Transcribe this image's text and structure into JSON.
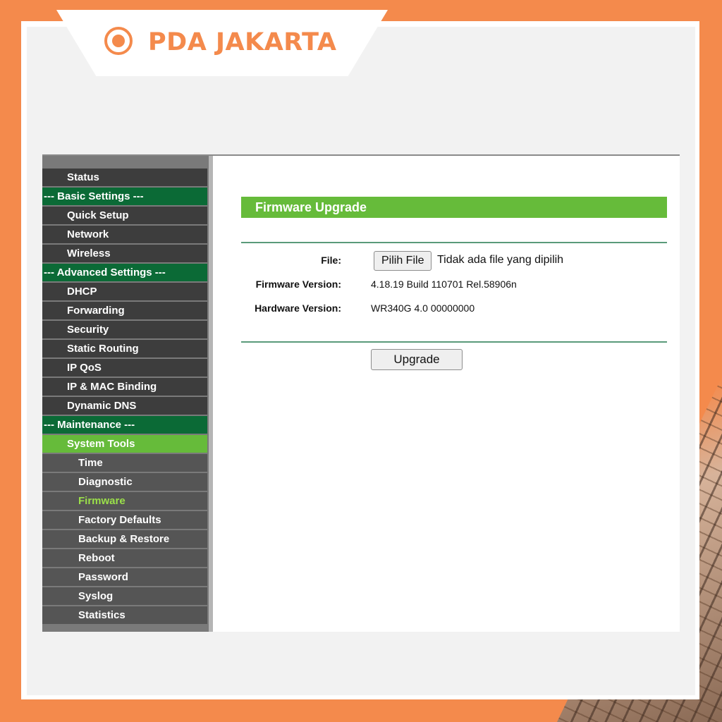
{
  "brand": {
    "name": "PDA JAKARTA",
    "accent": "#f48a4c"
  },
  "sidebar": {
    "items": [
      {
        "label": "Status",
        "level": 1
      },
      {
        "label": "--- Basic Settings ---",
        "level": 0
      },
      {
        "label": "Quick Setup",
        "level": 1
      },
      {
        "label": "Network",
        "level": 1
      },
      {
        "label": "Wireless",
        "level": 1
      },
      {
        "label": "--- Advanced Settings ---",
        "level": 0
      },
      {
        "label": "DHCP",
        "level": 1
      },
      {
        "label": "Forwarding",
        "level": 1
      },
      {
        "label": "Security",
        "level": 1
      },
      {
        "label": "Static Routing",
        "level": 1
      },
      {
        "label": "IP QoS",
        "level": 1
      },
      {
        "label": "IP & MAC Binding",
        "level": 1
      },
      {
        "label": "Dynamic DNS",
        "level": 1
      },
      {
        "label": "--- Maintenance ---",
        "level": 0
      },
      {
        "label": "System Tools",
        "level": 1,
        "active": true
      },
      {
        "label": "Time",
        "level": 2
      },
      {
        "label": "Diagnostic",
        "level": 2
      },
      {
        "label": "Firmware",
        "level": 2,
        "current": true
      },
      {
        "label": "Factory Defaults",
        "level": 2
      },
      {
        "label": "Backup & Restore",
        "level": 2
      },
      {
        "label": "Reboot",
        "level": 2
      },
      {
        "label": "Password",
        "level": 2
      },
      {
        "label": "Syslog",
        "level": 2
      },
      {
        "label": "Statistics",
        "level": 2
      }
    ]
  },
  "main": {
    "title": "Firmware Upgrade",
    "file_label": "File:",
    "file_button": "Pilih File",
    "file_status": "Tidak ada file yang dipilih",
    "firmware_label": "Firmware Version:",
    "firmware_value": "4.18.19 Build 110701 Rel.58906n",
    "hardware_label": "Hardware Version:",
    "hardware_value": "WR340G 4.0 00000000",
    "upgrade_button": "Upgrade"
  },
  "colors": {
    "menu_dark": "#3d3d3d",
    "menu_section": "#0b6a36",
    "menu_active": "#66bb3a",
    "title_bar": "#66bb3a"
  }
}
